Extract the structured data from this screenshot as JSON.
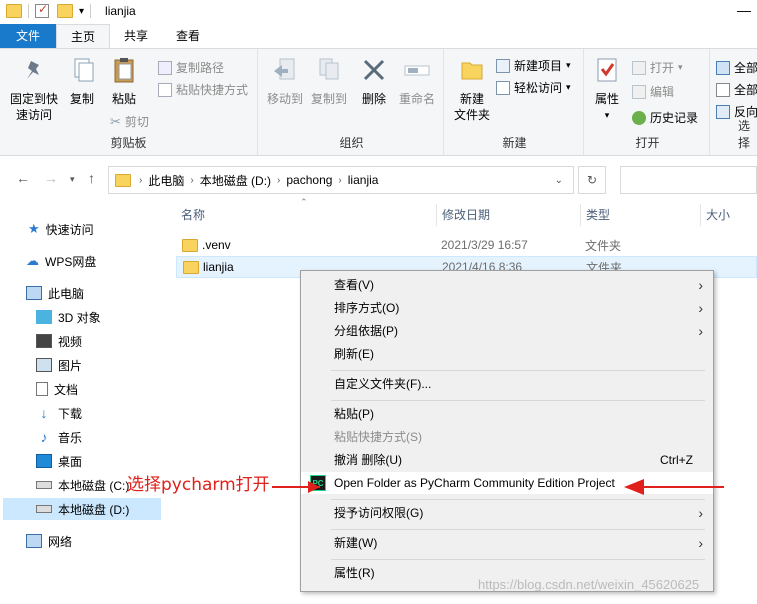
{
  "window": {
    "title": "lianjia"
  },
  "tabs": [
    "文件",
    "主页",
    "共享",
    "查看"
  ],
  "ribbon": {
    "clipboard": {
      "pin_label_line1": "固定到快",
      "pin_label_line2": "速访问",
      "copy_label": "复制",
      "paste_label": "粘贴",
      "copy_path_label": "复制路径",
      "paste_shortcut_label": "粘贴快捷方式",
      "cut_label": "剪切",
      "group_label": "剪贴板"
    },
    "organize": {
      "move_to_label": "移动到",
      "copy_to_label": "复制到",
      "delete_label": "删除",
      "rename_label": "重命名",
      "group_label": "组织"
    },
    "new": {
      "new_folder_line1": "新建",
      "new_folder_line2": "文件夹",
      "new_item_label": "新建项目",
      "easy_access_label": "轻松访问",
      "group_label": "新建"
    },
    "open": {
      "properties_label": "属性",
      "open_label": "打开",
      "edit_label": "编辑",
      "history_label": "历史记录",
      "group_label": "打开"
    },
    "select": {
      "select_all_label": "全部",
      "select_none_label": "全部",
      "invert_label": "反向",
      "group_label": "选择"
    }
  },
  "address": {
    "crumbs": [
      "此电脑",
      "本地磁盘 (D:)",
      "pachong",
      "lianjia"
    ]
  },
  "nav": {
    "items": [
      {
        "label": "快速访问",
        "icon": "star-icon"
      },
      {
        "label": "WPS网盘",
        "icon": "cloud-icon"
      },
      {
        "label": "此电脑",
        "icon": "computer-icon"
      },
      {
        "label": "3D 对象",
        "icon": "cube-icon"
      },
      {
        "label": "视频",
        "icon": "video-icon"
      },
      {
        "label": "图片",
        "icon": "picture-icon"
      },
      {
        "label": "文档",
        "icon": "document-icon"
      },
      {
        "label": "下载",
        "icon": "download-icon"
      },
      {
        "label": "音乐",
        "icon": "music-icon"
      },
      {
        "label": "桌面",
        "icon": "desktop-icon"
      },
      {
        "label": "本地磁盘 (C:)",
        "icon": "drive-icon"
      },
      {
        "label": "本地磁盘 (D:)",
        "icon": "drive-icon"
      },
      {
        "label": "网络",
        "icon": "network-icon"
      }
    ]
  },
  "columns": {
    "name": "名称",
    "modified": "修改日期",
    "type": "类型",
    "size": "大小"
  },
  "files": [
    {
      "name": ".venv",
      "modified": "2021/3/29 16:57",
      "type": "文件夹"
    },
    {
      "name": "lianjia",
      "modified": "2021/4/16 8:36",
      "type": "文件夹"
    }
  ],
  "context_menu": {
    "view": "查看(V)",
    "sort": "排序方式(O)",
    "group": "分组依据(P)",
    "refresh": "刷新(E)",
    "customize": "自定义文件夹(F)...",
    "paste": "粘贴(P)",
    "paste_shortcut": "粘贴快捷方式(S)",
    "undo_delete": "撤消 删除(U)",
    "undo_shortcut": "Ctrl+Z",
    "open_pycharm": "Open Folder as PyCharm Community Edition Project",
    "grant_access": "授予访问权限(G)",
    "new": "新建(W)",
    "properties": "属性(R)"
  },
  "annotation": {
    "text": "选择pycharm打开",
    "color": "#e0201a"
  },
  "watermark": "https://blog.csdn.net/weixin_45620625"
}
